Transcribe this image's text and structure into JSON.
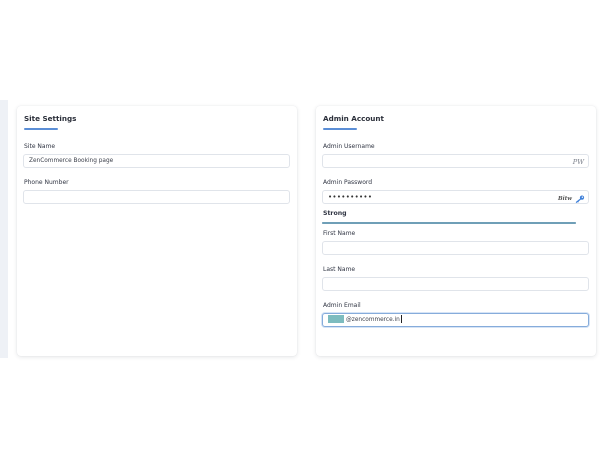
{
  "site_settings": {
    "title": "Site Settings",
    "site_name_label": "Site Name",
    "site_name_value": "ZenCommerce Booking page",
    "phone_label": "Phone Number",
    "phone_value": ""
  },
  "admin_account": {
    "title": "Admin Account",
    "username_label": "Admin Username",
    "username_value": "",
    "username_badge": "PW",
    "password_label": "Admin Password",
    "password_value": "••••••••••",
    "password_ext_icon_text": "Bitw",
    "password_key_icon": "key-icon",
    "strength_label": "Strong",
    "strength_level": 1.0,
    "first_name_label": "First Name",
    "first_name_value": "",
    "last_name_label": "Last Name",
    "last_name_value": "",
    "email_label": "Admin Email",
    "email_value": "@zencommerce.in",
    "accent_color": "#5b8ed6"
  }
}
